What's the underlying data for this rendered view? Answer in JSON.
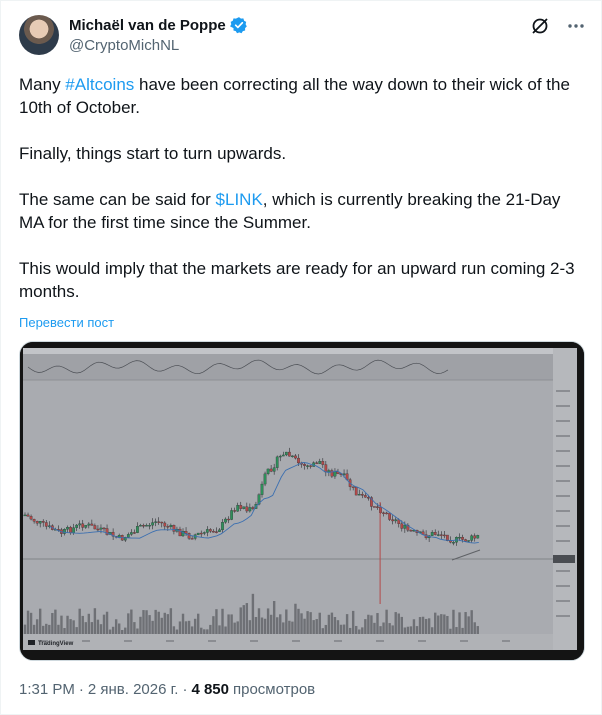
{
  "author": {
    "display_name": "Michaël van de Poppe",
    "handle": "@CryptoMichNL",
    "verified_color": "#1d9bf0"
  },
  "tweet": {
    "p1_before": "Many ",
    "p1_hashtag": "#Altcoins",
    "p1_after": " have been correcting all the way down to their wick of the 10th of October.",
    "p2": "Finally, things start to turn upwards.",
    "p3_before": "The same can be said for ",
    "p3_cashtag": "$LINK",
    "p3_after": ", which is currently breaking the 21-Day MA for the first time since the Summer.",
    "p4": "This would imply that the markets are ready for an upward run coming 2-3 months."
  },
  "translate_label": "Перевести пост",
  "chart_watermark": "TradingView",
  "footer": {
    "time": "1:31 PM",
    "separator": "·",
    "date": "2 янв. 2026 г.",
    "views_count": "4 850",
    "views_label": "просмотров"
  },
  "icons": {
    "grok": "grok-icon",
    "more": "more-icon",
    "verified": "verified-badge-icon"
  },
  "colors": {
    "accent": "#1d9bf0",
    "secondary_text": "#536471"
  }
}
